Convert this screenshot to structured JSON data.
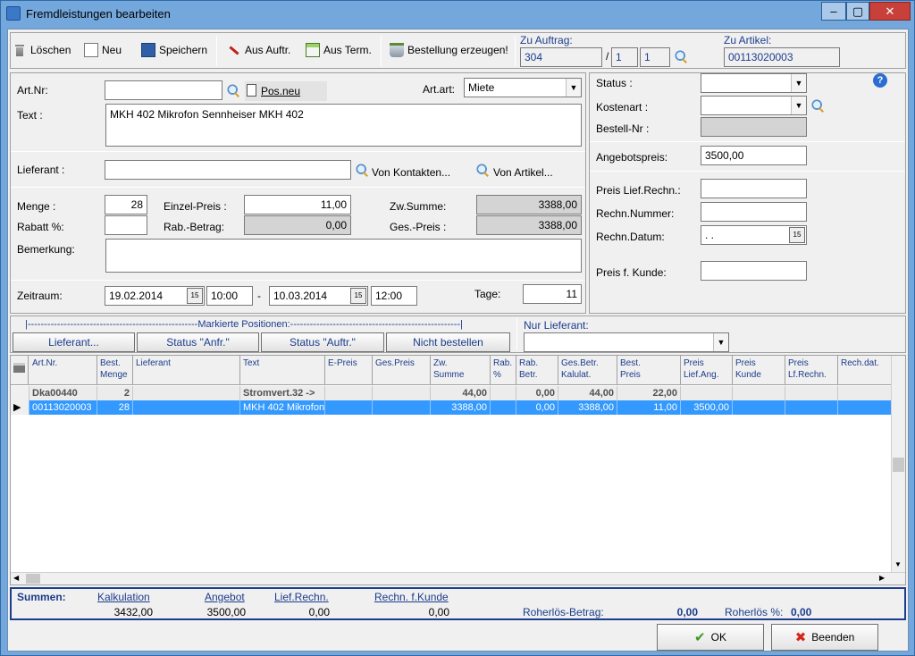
{
  "window": {
    "title": "Fremdleistungen bearbeiten",
    "minimize": "–",
    "maximize": "▢",
    "close": "✕"
  },
  "toolbar": {
    "delete": "Löschen",
    "new": "Neu",
    "save": "Speichern",
    "from_order": "Aus Auftr.",
    "from_term": "Aus Term.",
    "create_order": "Bestellung erzeugen!",
    "to_order_label": "Zu Auftrag:",
    "order_no": "304",
    "order_sep": "/",
    "order_pos1": "1",
    "order_pos2": "1",
    "to_article_label": "Zu Artikel:",
    "article_no": "00113020003"
  },
  "form": {
    "artnr_label": "Art.Nr:",
    "artnr_value": "",
    "pos_new": "Pos.neu",
    "artart_label": "Art.art:",
    "artart_value": "Miete",
    "text_label": "Text :",
    "text_value": "MKH 402 Mikrofon Sennheiser MKH 402",
    "supplier_label": "Lieferant :",
    "supplier_value": "",
    "from_contacts": "Von Kontakten...",
    "from_article": "Von Artikel...",
    "qty_label": "Menge :",
    "qty_value": "28",
    "unit_price_label": "Einzel-Preis :",
    "unit_price_value": "11,00",
    "subtotal_label": "Zw.Summe:",
    "subtotal_value": "3388,00",
    "discount_label": "Rabatt %:",
    "discount_value": "",
    "discount_amount_label": "Rab.-Betrag:",
    "discount_amount_value": "0,00",
    "total_label": "Ges.-Preis :",
    "total_value": "3388,00",
    "remark_label": "Bemerkung:",
    "remark_value": "",
    "period_label": "Zeitraum:",
    "date_from": "19.02.2014",
    "time_from": "10:00",
    "period_sep": "-",
    "date_to": "10.03.2014",
    "time_to": "12:00",
    "days_label": "Tage:",
    "days_value": "11"
  },
  "right": {
    "status_label": "Status :",
    "status_value": "",
    "cost_type_label": "Kostenart :",
    "cost_type_value": "",
    "order_nr_label": "Bestell-Nr :",
    "order_nr_value": "",
    "offer_price_label": "Angebotspreis:",
    "offer_price_value": "3500,00",
    "inv_price_label": "Preis Lief.Rechn.:",
    "inv_price_value": "",
    "inv_no_label": "Rechn.Nummer:",
    "inv_no_value": "",
    "inv_date_label": "Rechn.Datum:",
    "inv_date_value": " .  .",
    "cust_price_label": "Preis f. Kunde:",
    "cust_price_value": "",
    "help": "?"
  },
  "marked": {
    "header": "|----------------------------------------------------Markierte Positionen:----------------------------------------------------|",
    "btn_supplier": "Lieferant...",
    "btn_status_anfr": "Status \"Anfr.\"",
    "btn_status_auftr": "Status \"Auftr.\"",
    "btn_not_order": "Nicht bestellen",
    "only_supplier_label": "Nur Lieferant:",
    "only_supplier_value": ""
  },
  "grid": {
    "columns": [
      [
        "Art.Nr.",
        ""
      ],
      [
        "Best.",
        "Menge"
      ],
      [
        "Lieferant",
        ""
      ],
      [
        "Text",
        ""
      ],
      [
        "E-Preis",
        ""
      ],
      [
        "Ges.Preis",
        ""
      ],
      [
        "Zw.",
        "Summe"
      ],
      [
        "Rab.",
        "%"
      ],
      [
        "Rab.",
        "Betr."
      ],
      [
        "Ges.Betr.",
        "Kalulat."
      ],
      [
        "Best.",
        "Preis"
      ],
      [
        "Preis",
        "Lief.Ang."
      ],
      [
        "Preis",
        "Kunde"
      ],
      [
        "Preis",
        "Lf.Rechn."
      ],
      [
        "Rech.dat.",
        ""
      ]
    ],
    "rows": [
      [
        "Dka00440",
        "2",
        "",
        "Stromvert.32 ->",
        "",
        "",
        "44,00",
        "",
        "0,00",
        "44,00",
        "22,00",
        "",
        "",
        "",
        ""
      ],
      [
        "00113020003",
        "28",
        "",
        "MKH 402 Mikrofon",
        "",
        "",
        "3388,00",
        "",
        "0,00",
        "3388,00",
        "11,00",
        "3500,00",
        "",
        "",
        ""
      ]
    ]
  },
  "footer": {
    "sums_label": "Summen:",
    "calc_label": "Kalkulation",
    "calc_value": "3432,00",
    "offer_label": "Angebot",
    "offer_value": "3500,00",
    "lief_label": "Lief.Rechn.",
    "lief_value": "0,00",
    "kunde_label": "Rechn. f.Kunde",
    "kunde_value": "0,00",
    "gross_label": "Roherlös-Betrag:",
    "gross_value": "0,00",
    "gross_pct_label": "Roherlös %:",
    "gross_pct_value": "0,00"
  },
  "buttons": {
    "ok": "OK",
    "exit": "Beenden"
  }
}
